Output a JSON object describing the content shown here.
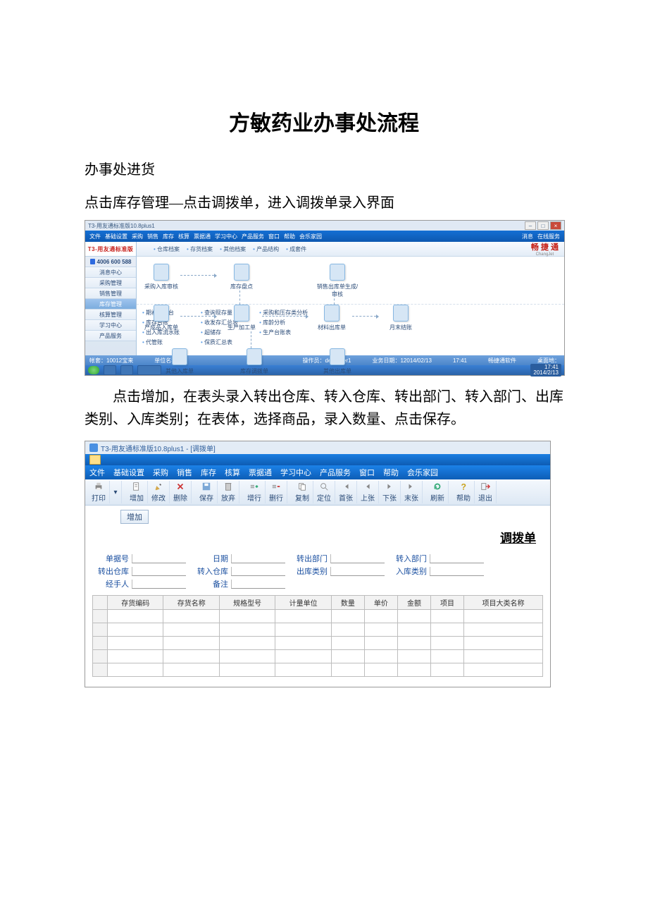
{
  "doc": {
    "title": "方敏药业办事处流程",
    "section1": "办事处进货",
    "para1": "点击库存管理—点击调拨单，进入调拨单录入界面",
    "para2_a": "点击增加，在表头录入转出仓库、转入仓库、转出部门、转入部门、出库类别、入库类别；在表体，选择商品，录入数量、点击保存。"
  },
  "app1": {
    "title": "T3-用友通标准版10.8plus1",
    "menubar": [
      "文件",
      "基础设置",
      "采购",
      "销售",
      "库存",
      "核算",
      "票据通",
      "学习中心",
      "产品服务",
      "窗口",
      "帮助",
      "会乐家园"
    ],
    "menubar_links": [
      "消息",
      "在线服务"
    ],
    "brand": "T3-用友通标准版",
    "hotline": "4006 600 588",
    "side": [
      "消息中心",
      "采购管理",
      "销售管理",
      "库存管理",
      "核算管理",
      "学习中心",
      "产品服务"
    ],
    "side_active": 3,
    "toolstrip": [
      "仓库档案",
      "存货档案",
      "其他档案",
      "产品结构",
      "成套件"
    ],
    "toolstrip_logo": "畅 捷 通",
    "toolstrip_logo_sub": "ChangJet",
    "nodes": {
      "r1": [
        "采购入库审核",
        "库存盘点",
        "销售出库单生成/审核"
      ],
      "r2": [
        "产成品入库单",
        "生产加工单",
        "材料出库单",
        "月末结账"
      ],
      "r3": [
        "其他入库单",
        "库存调拨单",
        "其他出库单"
      ]
    },
    "reports": {
      "c1": [
        "期初工作台",
        "库存台账",
        "出入库流水账",
        "代管账"
      ],
      "c2": [
        "查询现存量",
        "收发存汇总表",
        "超储存",
        "保质汇总表"
      ],
      "c3": [
        "采购和压存类分析",
        "库龄分析",
        "生产台账表"
      ]
    },
    "status": {
      "left": "帐套：10012宝来",
      "unit": "单位名称：",
      "op": "操作员：dev-User1",
      "date": "业务日期：12014/02/13",
      "time": "17:41",
      "svc": "畅捷通软件",
      "net": "桌面地：",
      "clock_top": "17:41",
      "clock_bot": "2014/2/13"
    }
  },
  "app2": {
    "title": "T3-用友通标准版10.8plus1 - [调拨单]",
    "menu": [
      "文件",
      "基础设置",
      "采购",
      "销售",
      "库存",
      "核算",
      "票据通",
      "学习中心",
      "产品服务",
      "窗口",
      "帮助",
      "会乐家园"
    ],
    "toolbar": [
      "打印",
      "增加",
      "修改",
      "删除",
      "保存",
      "放弃",
      "增行",
      "删行",
      "复制",
      "定位",
      "首张",
      "上张",
      "下张",
      "末张",
      "刷新",
      "帮助",
      "退出"
    ],
    "addbtn": "增加",
    "voucher_title": "调拨单",
    "fields_row1": [
      {
        "label": "单据号",
        "key": "docno"
      },
      {
        "label": "日期",
        "key": "date"
      },
      {
        "label": "转出部门",
        "key": "outdept"
      },
      {
        "label": "转入部门",
        "key": "indept"
      }
    ],
    "fields_row2": [
      {
        "label": "转出仓库",
        "key": "outwh"
      },
      {
        "label": "转入仓库",
        "key": "inwh"
      },
      {
        "label": "出库类别",
        "key": "outtype"
      },
      {
        "label": "入库类别",
        "key": "intype"
      }
    ],
    "fields_row3": [
      {
        "label": "经手人",
        "key": "handler"
      },
      {
        "label": "备注",
        "key": "memo"
      }
    ],
    "columns": [
      "存货编码",
      "存货名称",
      "规格型号",
      "计量单位",
      "数量",
      "单价",
      "金额",
      "项目",
      "项目大类名称"
    ]
  }
}
